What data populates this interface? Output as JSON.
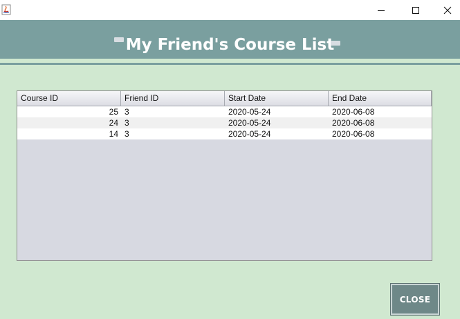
{
  "window": {
    "minimize_glyph": "—",
    "maximize_glyph": "☐",
    "close_glyph": "✕"
  },
  "header": {
    "title": "My Friend's Course List"
  },
  "table": {
    "columns": [
      "Course ID",
      "Friend ID",
      "Start Date",
      "End Date"
    ],
    "rows": [
      {
        "course_id": "25",
        "friend_id": "3",
        "start_date": "2020-05-24",
        "end_date": "2020-06-08"
      },
      {
        "course_id": "24",
        "friend_id": "3",
        "start_date": "2020-05-24",
        "end_date": "2020-06-08"
      },
      {
        "course_id": "14",
        "friend_id": "3",
        "start_date": "2020-05-24",
        "end_date": "2020-06-08"
      }
    ]
  },
  "footer": {
    "close_label": "CLOSE"
  },
  "colors": {
    "background": "#d0e8d0",
    "header": "#7a9f9f",
    "button": "#6e8888"
  }
}
